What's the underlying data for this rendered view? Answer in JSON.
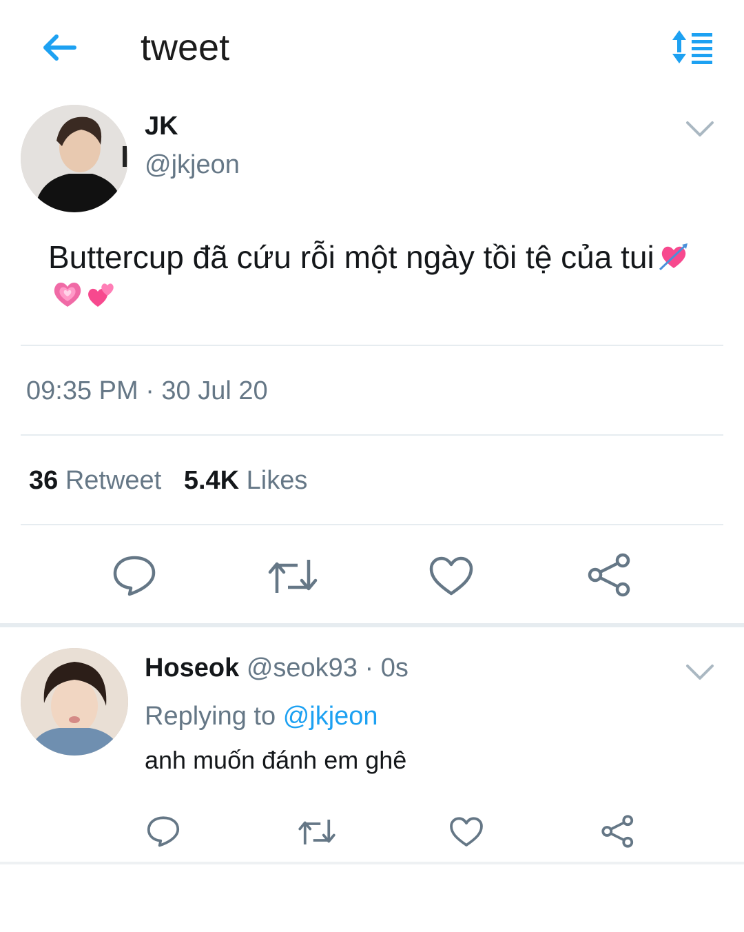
{
  "header": {
    "title": "tweet"
  },
  "tweet": {
    "author_name": "JK",
    "author_handle": "@jkjeon",
    "text": "Buttercup đã cứu rỗi một ngày tồi tệ của tui",
    "emojis": [
      "heart-with-arrow-emoji",
      "growing-heart-emoji",
      "two-hearts-emoji"
    ],
    "timestamp": "09:35 PM · 30 Jul 20",
    "retweet_count": "36",
    "retweet_label": "Retweet",
    "likes_count": "5.4K",
    "likes_label": "Likes"
  },
  "reply": {
    "author_name": "Hoseok",
    "author_handle": "@seok93",
    "time": "· 0s",
    "replying_label": "Replying to",
    "replying_handle": "@jkjeon",
    "text": "anh muốn đánh em ghê"
  },
  "colors": {
    "accent": "#1da1f2",
    "secondary_text": "#657786",
    "divider": "#e6ecf0",
    "emoji_pink": "#f7498e"
  }
}
